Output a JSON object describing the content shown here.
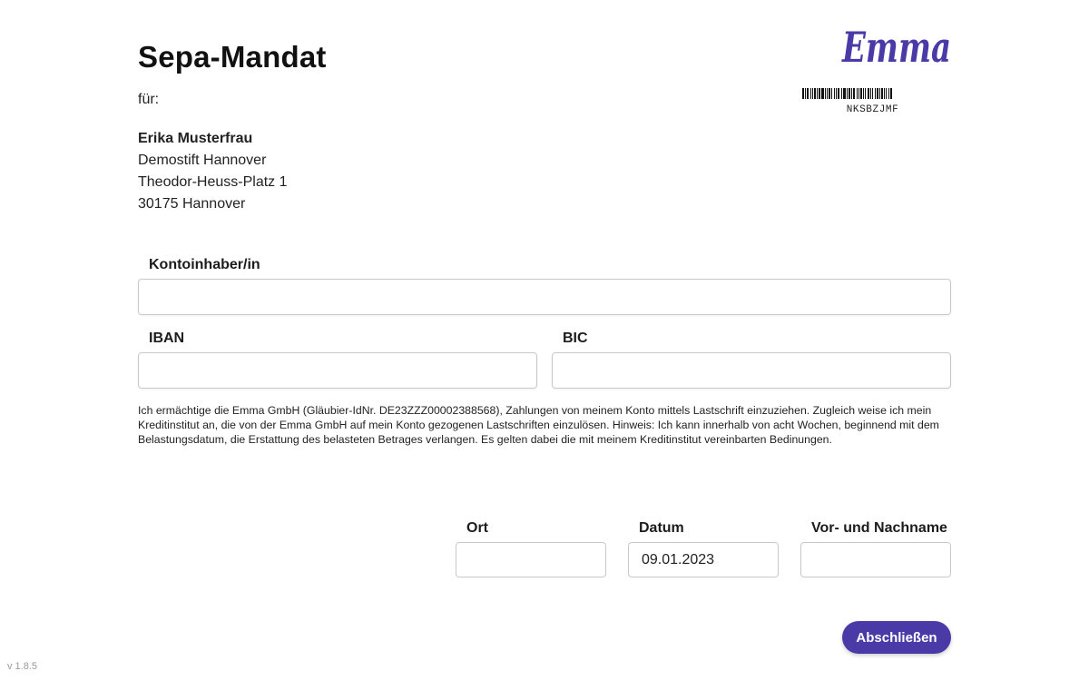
{
  "header": {
    "title": "Sepa-Mandat",
    "for_label": "für:"
  },
  "brand": {
    "logo_text": "Emma",
    "color": "#4a3aa8"
  },
  "barcode": {
    "code": "NKSBZJMF"
  },
  "recipient": {
    "name": "Erika Musterfrau",
    "line1": "Demostift Hannover",
    "line2": "Theodor-Heuss-Platz 1",
    "line3": "30175 Hannover"
  },
  "form": {
    "account_holder": {
      "label": "Kontoinhaber/in",
      "value": ""
    },
    "iban": {
      "label": "IBAN",
      "value": ""
    },
    "bic": {
      "label": "BIC",
      "value": ""
    },
    "place": {
      "label": "Ort",
      "value": ""
    },
    "date": {
      "label": "Datum",
      "value": "09.01.2023"
    },
    "full_name": {
      "label": "Vor- und Nachname",
      "value": ""
    }
  },
  "legal_text": "Ich ermächtige die Emma GmbH (Gläubier-IdNr. DE23ZZZ00002388568), Zahlungen von meinem Konto mittels Lastschrift einzuziehen. Zugleich weise ich mein Kreditinstitut an, die von der Emma GmbH auf mein Konto gezogenen Lastschriften einzulösen. Hinweis: Ich kann innerhalb von acht Wochen, beginnend mit dem Belastungsdatum, die Erstattung des belasteten Betrages verlangen. Es gelten dabei die mit meinem Kreditinstitut vereinbarten Bedinungen.",
  "actions": {
    "submit_label": "Abschließen"
  },
  "footer": {
    "version": "v 1.8.5"
  }
}
